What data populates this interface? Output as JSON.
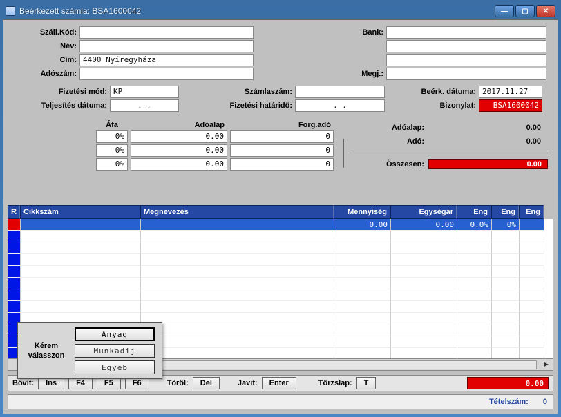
{
  "window": {
    "title": "Beérkezett számla:  BSA1600042"
  },
  "header": {
    "szall_kod_label": "Száll.Kód:",
    "szall_kod": "",
    "nev_label": "Név:",
    "nev": "",
    "cim_label": "Cím:",
    "cim": "4400 Nyíregyháza",
    "adoszam_label": "Adószám:",
    "adoszam": "",
    "bank_label": "Bank:",
    "bank1": "",
    "bank2": "",
    "bank3": "",
    "megj_label": "Megj.:",
    "megj": ""
  },
  "pay": {
    "fizmod_label": "Fizetési mód:",
    "fizmod": "KP",
    "teljdat_label": "Teljesítés dátuma:",
    "teljdat": ".  .",
    "szamlaszam_label": "Számlaszám:",
    "szamlaszam": "",
    "fizhat_label": "Fizetési határidö:",
    "fizhat": ".  .",
    "beerk_label": "Beérk. dátuma:",
    "beerk": "2017.11.27",
    "bizonylat_label": "Bizonylat:",
    "bizonylat": "BSA1600042"
  },
  "vat": {
    "afa_label": "Áfa",
    "adoalap_label": "Adóalap",
    "forgado_label": "Forg.adó",
    "rows": [
      {
        "afa": "0%",
        "alap": "0.00",
        "forg": "0"
      },
      {
        "afa": "0%",
        "alap": "0.00",
        "forg": "0"
      },
      {
        "afa": "0%",
        "alap": "0.00",
        "forg": "0"
      }
    ]
  },
  "totals": {
    "adoalap_label": "Adóalap:",
    "adoalap": "0.00",
    "ado_label": "Adó:",
    "ado": "0.00",
    "osszesen_label": "Összesen:",
    "osszesen": "0.00"
  },
  "grid": {
    "cols": {
      "R": "R",
      "cikk": "Cikkszám",
      "meg": "Megnevezés",
      "menny": "Mennyiség",
      "egys": "Egységár",
      "eng1": "Eng",
      "eng2": "Eng",
      "eng3": "Eng"
    },
    "row0": {
      "cikk": "",
      "meg": "",
      "menny": "0.00",
      "egys": "0.00",
      "eng1": "0.0%",
      "eng2": "0%",
      "eng3": ""
    }
  },
  "actions": {
    "bovit": "Bővít:",
    "ins": "Ins",
    "f4": "F4",
    "f5": "F5",
    "f6": "F6",
    "torol": "Töröl:",
    "del": "Del",
    "javit": "Javít:",
    "enter": "Enter",
    "torzslap": "Törzslap:",
    "t": "T",
    "gtotal": "0.00"
  },
  "status": {
    "tetelszam_label": "Tételszám:",
    "tetelszam": "0"
  },
  "popup": {
    "prompt": "Kérem válasszon",
    "anyag": "Anyag",
    "munkadij": "Munkadij",
    "egyeb": "Egyeb"
  }
}
